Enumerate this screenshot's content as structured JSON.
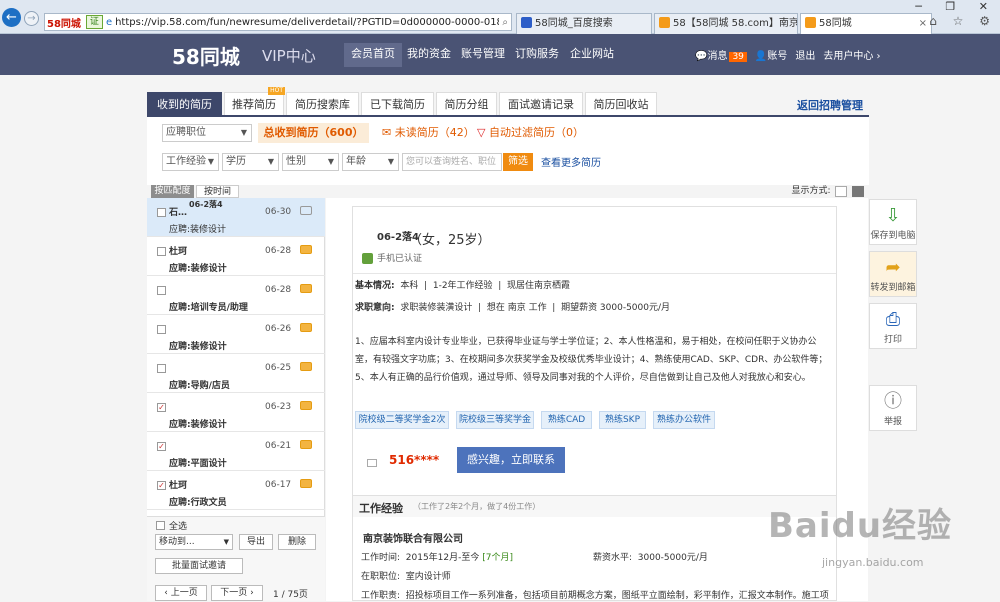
{
  "browser": {
    "address_tag": "58同城",
    "cert": "证",
    "url": "https://vip.58.com/fun/newresume/deliverdetail/?PGTID=0d000000-0000-018c-76",
    "tabs": [
      {
        "label": "58同城_百度搜索"
      },
      {
        "label": "58【58同城 58.com】南京分类..."
      },
      {
        "label": "58同城"
      }
    ],
    "window_controls": "─ ❐ ✕",
    "toolbar_icons": "⌂ ☆ ⚙"
  },
  "header": {
    "logo": "58同城",
    "subtitle": "VIP中心",
    "nav": [
      "会员首页",
      "我的资金",
      "账号管理",
      "订购服务",
      "企业网站"
    ],
    "msg_label": "消息",
    "msg_count": "39",
    "account": "账号",
    "logout": "退出",
    "user_center": "去用户中心 ›"
  },
  "tabs": {
    "items": [
      "收到的简历",
      "推荐简历",
      "简历搜索库",
      "已下载简历",
      "简历分组",
      "面试邀请记录",
      "简历回收站"
    ],
    "hot": "HOT",
    "return": "返回招聘管理"
  },
  "filters": {
    "position": "应聘职位",
    "total": "总收到简历（600）",
    "unread": "未读简历（42）",
    "auto": "自动过滤简历（0）",
    "experience": "工作经验",
    "education": "学历",
    "gender": "性别",
    "age": "年龄",
    "search_placeholder": "您可以查询姓名、职位",
    "search_btn": "筛选",
    "more": "查看更多简历"
  },
  "sort": {
    "by_match": "按匹配度",
    "by_time": "按时间",
    "display": "显示方式:"
  },
  "resume_list": [
    {
      "name": "石…",
      "date": "06-30",
      "position": "应聘:装修设计",
      "tag": "06-2落4",
      "checked": false,
      "unread": false,
      "active": true
    },
    {
      "name": "杜珂",
      "date": "06-28",
      "position": "应聘:装修设计",
      "checked": false,
      "unread": true,
      "active": false
    },
    {
      "name": "",
      "date": "06-28",
      "position": "应聘:培训专员/助理",
      "checked": false,
      "unread": true,
      "active": false
    },
    {
      "name": "",
      "date": "06-26",
      "position": "应聘:装修设计",
      "checked": false,
      "unread": true,
      "active": false
    },
    {
      "name": "",
      "date": "06-25",
      "position": "应聘:导购/店员",
      "checked": false,
      "unread": true,
      "active": false
    },
    {
      "name": "",
      "date": "06-23",
      "position": "应聘:装修设计",
      "checked": true,
      "unread": true,
      "active": false
    },
    {
      "name": "",
      "date": "06-21",
      "position": "应聘:平面设计",
      "checked": true,
      "unread": true,
      "active": false
    },
    {
      "name": "杜珂",
      "date": "06-17",
      "position": "应聘:行政文员",
      "checked": true,
      "unread": true,
      "active": false
    }
  ],
  "list_footer": {
    "select_all": "全选",
    "move_to": "移动到...",
    "export": "导出",
    "delete": "删除",
    "batch": "批量面试邀请",
    "prev": "‹ 上一页",
    "next": "下一页 ›",
    "page": "1 / 75页"
  },
  "detail": {
    "name_tag": "06-2落4",
    "gender_age": "（女，25岁）",
    "phone_verified": "手机已认证",
    "basic_label": "基本情况:",
    "basic": [
      "本科",
      "1-2年工作经验",
      "现居住南京栖霞"
    ],
    "intent_label": "求职意向:",
    "intent": [
      "求职装修装潢设计",
      "想在 南京 工作",
      "期望薪资 3000-5000元/月"
    ],
    "desc": "1、应届本科室内设计专业毕业，已获得毕业证与学士学位证；2、本人性格温和，易于相处，在校间任职于义协办公室，有较强文字功底；3、在校期间多次获奖学金及校级优秀毕业设计；4、熟练使用CAD、SKP、CDR、办公软件等；5、本人有正确的品行价值观，通过导师、领导及同事对我的个人评价，尽自信做到让自己及他人对我放心和安心。",
    "skills": [
      "院校级二等奖学金2次",
      "院校级三等奖学金",
      "熟练CAD",
      "熟练SKP",
      "熟练办公软件"
    ],
    "phone": "516****",
    "contact_btn": "感兴趣，立即联系",
    "exp_title": "工作经验",
    "exp_sub": "（工作了2年2个月，做了4份工作）",
    "company": "南京装饰联合有限公司",
    "time_label": "工作时间:",
    "time": "2015年12月-至今",
    "duration": "[7个月]",
    "salary_label": "薪资水平:",
    "salary": "3000-5000元/月",
    "job_label": "在职职位:",
    "job": "室内设计师",
    "duty_label": "工作职责:",
    "duty": "招投标项目工作一系列准备，包括项目前期概念方案，图纸平立面绘制，彩平制作，汇报文本制作。施工项"
  },
  "tools": [
    {
      "label": "保存到电脑",
      "icon": "⇩"
    },
    {
      "label": "转发到邮箱",
      "icon": "➦"
    },
    {
      "label": "打印",
      "icon": "⎙"
    },
    {
      "label": "举报",
      "icon": "ⓘ"
    }
  ],
  "watermark": {
    "brand": "Baidu经验",
    "url": "jingyan.baidu.com"
  },
  "colors": {
    "header": "#4a5374",
    "tab_active": "#3d476a",
    "orange": "#f08b10",
    "link": "#1a4fa0"
  }
}
